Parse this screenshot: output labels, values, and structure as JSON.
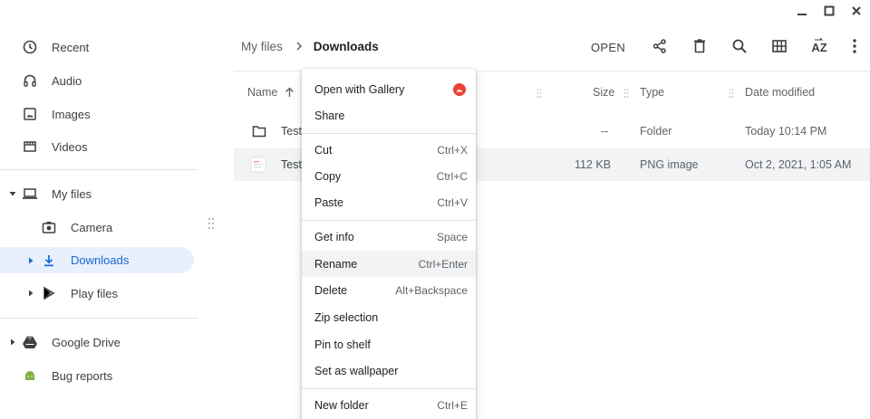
{
  "window": {
    "controls": [
      "minimize-icon",
      "maximize-icon",
      "close-icon"
    ]
  },
  "sidebar": {
    "items": [
      {
        "label": "Recent",
        "icon": "clock-icon"
      },
      {
        "label": "Audio",
        "icon": "headphones-icon"
      },
      {
        "label": "Images",
        "icon": "image-icon"
      },
      {
        "label": "Videos",
        "icon": "film-icon"
      },
      {
        "label": "My files",
        "icon": "laptop-icon",
        "expanded": true
      },
      {
        "label": "Camera",
        "icon": "camera-icon"
      },
      {
        "label": "Downloads",
        "icon": "download-icon",
        "selected": true
      },
      {
        "label": "Play files",
        "icon": "play-store-icon"
      },
      {
        "label": "Google Drive",
        "icon": "google-drive-icon"
      },
      {
        "label": "Bug reports",
        "icon": "android-icon"
      }
    ]
  },
  "breadcrumb": {
    "root": "My files",
    "current": "Downloads"
  },
  "toolbar": {
    "open_label": "OPEN",
    "icons": [
      "share-icon",
      "delete-icon",
      "search-icon",
      "grid-view-icon",
      "sort-az-icon",
      "more-vert-icon"
    ],
    "sort_label": "AZ"
  },
  "table": {
    "columns": {
      "name": "Name",
      "size": "Size",
      "type": "Type",
      "date": "Date modified"
    },
    "rows": [
      {
        "name": "Test",
        "size": "--",
        "type": "Folder",
        "date": "Today 10:14 PM",
        "icon": "folder-icon"
      },
      {
        "name": "Test",
        "size": "112 KB",
        "type": "PNG image",
        "date": "Oct 2, 2021, 1:05 AM",
        "icon": "image-file-icon",
        "selected": true
      }
    ]
  },
  "context_menu": {
    "groups": [
      [
        {
          "label": "Open with Gallery",
          "shortcut": "",
          "icon": "gallery-icon"
        },
        {
          "label": "Share",
          "shortcut": ""
        }
      ],
      [
        {
          "label": "Cut",
          "shortcut": "Ctrl+X"
        },
        {
          "label": "Copy",
          "shortcut": "Ctrl+C"
        },
        {
          "label": "Paste",
          "shortcut": "Ctrl+V"
        }
      ],
      [
        {
          "label": "Get info",
          "shortcut": "Space"
        },
        {
          "label": "Rename",
          "shortcut": "Ctrl+Enter",
          "hover": true
        },
        {
          "label": "Delete",
          "shortcut": "Alt+Backspace"
        },
        {
          "label": "Zip selection",
          "shortcut": ""
        },
        {
          "label": "Pin to shelf",
          "shortcut": ""
        },
        {
          "label": "Set as wallpaper",
          "shortcut": ""
        }
      ],
      [
        {
          "label": "New folder",
          "shortcut": "Ctrl+E"
        }
      ]
    ]
  },
  "colors": {
    "accent": "#1967d2",
    "selected_bg": "#e8f0fe",
    "row_selected": "#f1f3f4",
    "gallery_red": "#e94235"
  }
}
